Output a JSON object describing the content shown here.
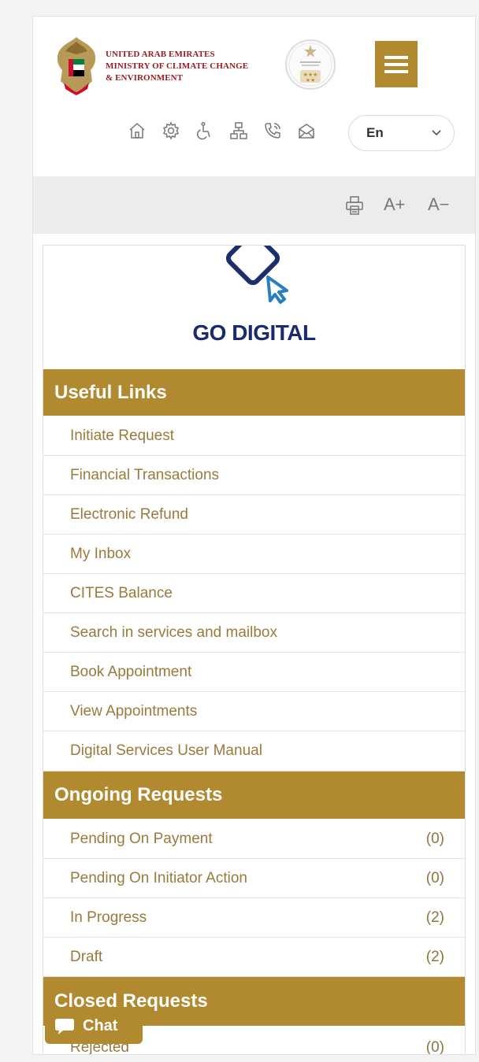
{
  "header": {
    "ministry_lines": [
      "UNITED ARAB EMIRATES",
      "MINISTRY OF CLIMATE CHANGE",
      "& ENVIRONMENT"
    ],
    "language": "En",
    "icons": [
      "home-icon",
      "settings-icon",
      "accessibility-icon",
      "sitemap-icon",
      "phone-icon",
      "mail-icon"
    ]
  },
  "toolbar": {
    "print_icon": "print-icon",
    "increase_font": "A+",
    "decrease_font": "A−"
  },
  "logo_text": "GO DIGITAL",
  "useful_links": {
    "title": "Useful Links",
    "items": [
      "Initiate Request",
      "Financial Transactions",
      "Electronic Refund",
      "My Inbox",
      "CITES Balance",
      "Search in services and mailbox",
      "Book Appointment",
      "View Appointments",
      "Digital Services User Manual"
    ]
  },
  "ongoing_requests": {
    "title": "Ongoing Requests",
    "items": [
      {
        "label": "Pending On Payment",
        "count": "(0)"
      },
      {
        "label": "Pending On Initiator Action",
        "count": "(0)"
      },
      {
        "label": "In Progress",
        "count": "(2)"
      },
      {
        "label": "Draft",
        "count": "(2)"
      }
    ]
  },
  "closed_requests": {
    "title": "Closed Requests",
    "items": [
      {
        "label": "Rejected",
        "count": "(0)"
      }
    ]
  },
  "chat": {
    "label": "Chat"
  },
  "colors": {
    "gold": "#b1892f",
    "link_text": "#9a7a3c",
    "brand_red": "#9a1b1f",
    "logo_navy": "#1a2a6c"
  }
}
